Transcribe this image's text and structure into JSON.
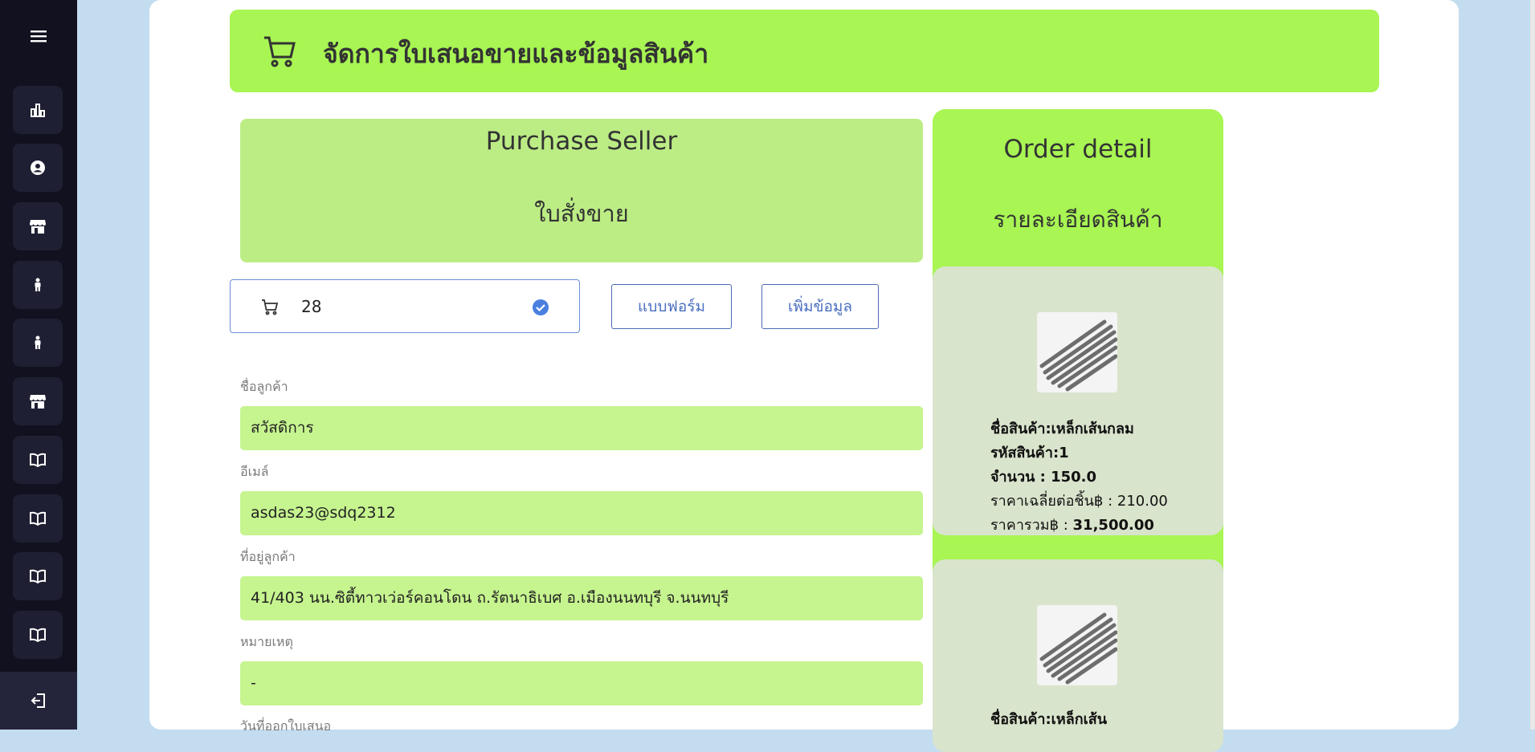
{
  "header": {
    "title": "จัดการใบเสนอขายและข้อมูลสินค้า"
  },
  "purchase_card": {
    "title_en": "Purchase Seller",
    "title_th": "ใบสั่งขาย"
  },
  "order_id": {
    "value": "28"
  },
  "buttons": {
    "form": "แบบฟอร์ม",
    "add": "เพิ่มข้อมูล"
  },
  "form": {
    "customer_name": {
      "label": "ชื่อลูกค้า",
      "value": "สวัสดิการ"
    },
    "email": {
      "label": "อีเมล์",
      "value": "asdas23@sdq2312"
    },
    "address": {
      "label": "ที่อยู่ลูกค้า",
      "value": "41/403 นน.ซิตี้ทาวเว่อร์คอนโดน ถ.รัตนาธิเบศ อ.เมืองนนทบุรี จ.นนทบุรี"
    },
    "note": {
      "label": "หมายเหตุ",
      "value": "-"
    },
    "issue_date": {
      "label": "วันที่ออกใบเสนอ"
    }
  },
  "order_detail": {
    "title_en": "Order detail",
    "title_th": "รายละเอียดสินค้า",
    "items": [
      {
        "name_label": "ชื่อสินค้า:",
        "name": "เหล็กเส้นกลม",
        "code_label": "รหัสสินค้า:",
        "code": "1",
        "qty_label": "จำนวน : ",
        "qty": "150.0",
        "avg_label": "ราคาเฉลี่ยต่อชิ้น฿ : ",
        "avg": "210.00",
        "total_label": "ราคารวม฿ : ",
        "total": "31,500.00"
      },
      {
        "name_label": "ชื่อสินค้า:",
        "name": "เหล็กเส้น"
      }
    ]
  },
  "sidebar": {
    "icons": [
      "menu-icon",
      "chart-icon",
      "user-circle-icon",
      "store-icon",
      "person-icon",
      "person-icon",
      "store-icon",
      "book-icon",
      "book-icon",
      "book-icon",
      "book-icon",
      "logout-icon"
    ]
  },
  "colors": {
    "sidebar": "#11111f",
    "accent_green": "#a8f553",
    "form_field": "#c6f48f",
    "button_blue": "#4a6fc0",
    "background": "#c3dcef"
  }
}
